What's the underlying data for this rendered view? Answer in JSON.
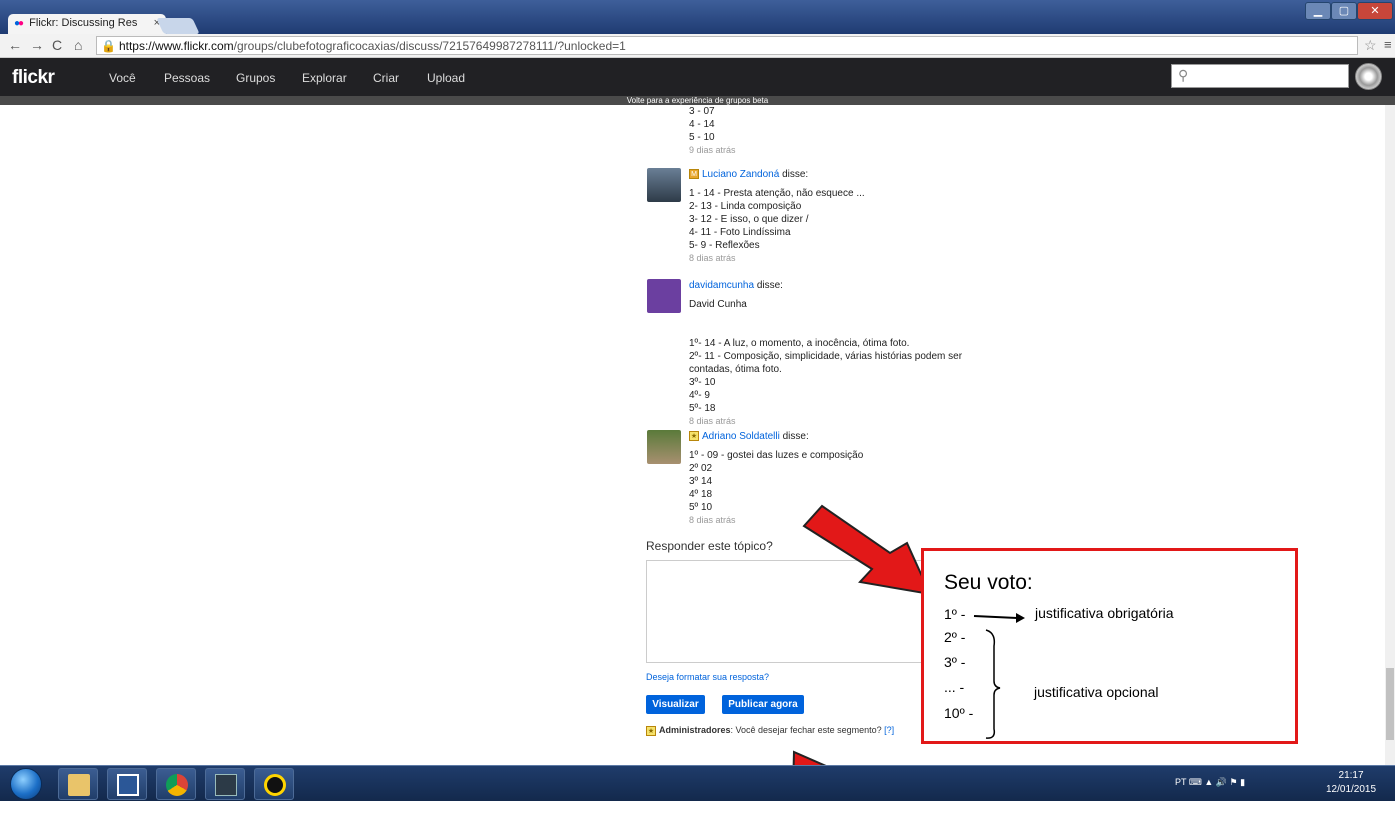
{
  "browser": {
    "tab_title": "Flickr: Discussing Res",
    "tab_close": "×",
    "url_host": "https://www.flickr.com",
    "url_path": "/groups/clubefotograficocaxias/discuss/72157649987278111/?unlocked=1"
  },
  "nav": {
    "logo": "flickr",
    "items": [
      "Você",
      "Pessoas",
      "Grupos",
      "Explorar",
      "Criar",
      "Upload"
    ],
    "search_icon": "search-icon",
    "beta_bar": "Volte para a experiência de grupos beta"
  },
  "first_post": {
    "lines": [
      "3 - 07",
      "4 - 14",
      "5 - 10"
    ],
    "time": "9 dias atrás"
  },
  "posts": [
    {
      "author": "Luciano Zandoná",
      "badge": "M",
      "said": "disse:",
      "lines": [
        "1 - 14 - Presta atenção, não esquece ...",
        "2- 13 - Linda composição",
        "3- 12 - E isso, o que dizer /",
        "4- 11 - Foto Lindíssima",
        "5- 9 - Reflexões"
      ],
      "time": "8 dias atrás"
    },
    {
      "author": "davidamcunha",
      "badge": "",
      "said": "disse:",
      "name_line": "David Cunha",
      "lines": [
        "1º- 14 - A luz, o momento, a inocência, ótima foto.",
        "2º- 11 - Composição, simplicidade, várias histórias podem ser",
        "contadas, ótima foto.",
        "3º- 10",
        "4º- 9",
        "5º- 18"
      ],
      "time": "8 dias atrás"
    },
    {
      "author": "Adriano Soldatelli",
      "badge": "★",
      "said": "disse:",
      "lines": [
        "1º - 09 - gostei das luzes e composição",
        "2º 02",
        "3º 14",
        "4º 18",
        "5º 10"
      ],
      "time": "8 dias atrás"
    }
  ],
  "reply": {
    "title": "Responder este tópico?",
    "format_link": "Deseja formatar sua resposta?",
    "preview_button": "Visualizar",
    "publish_button": "Publicar agora",
    "admin_label": "Administradores",
    "admin_text": ": Você desejar fechar este segmento?",
    "admin_help": "[?]"
  },
  "annotation": {
    "title": "Seu voto:",
    "lines": [
      "1º -",
      "2º -",
      "3º -",
      "... -",
      "10º -"
    ],
    "required": "justificativa obrigatória",
    "optional": "justificativa opcional",
    "color": "#e21818"
  },
  "taskbar": {
    "tray_lang": "PT",
    "time": "21:17",
    "date": "12/01/2015"
  }
}
